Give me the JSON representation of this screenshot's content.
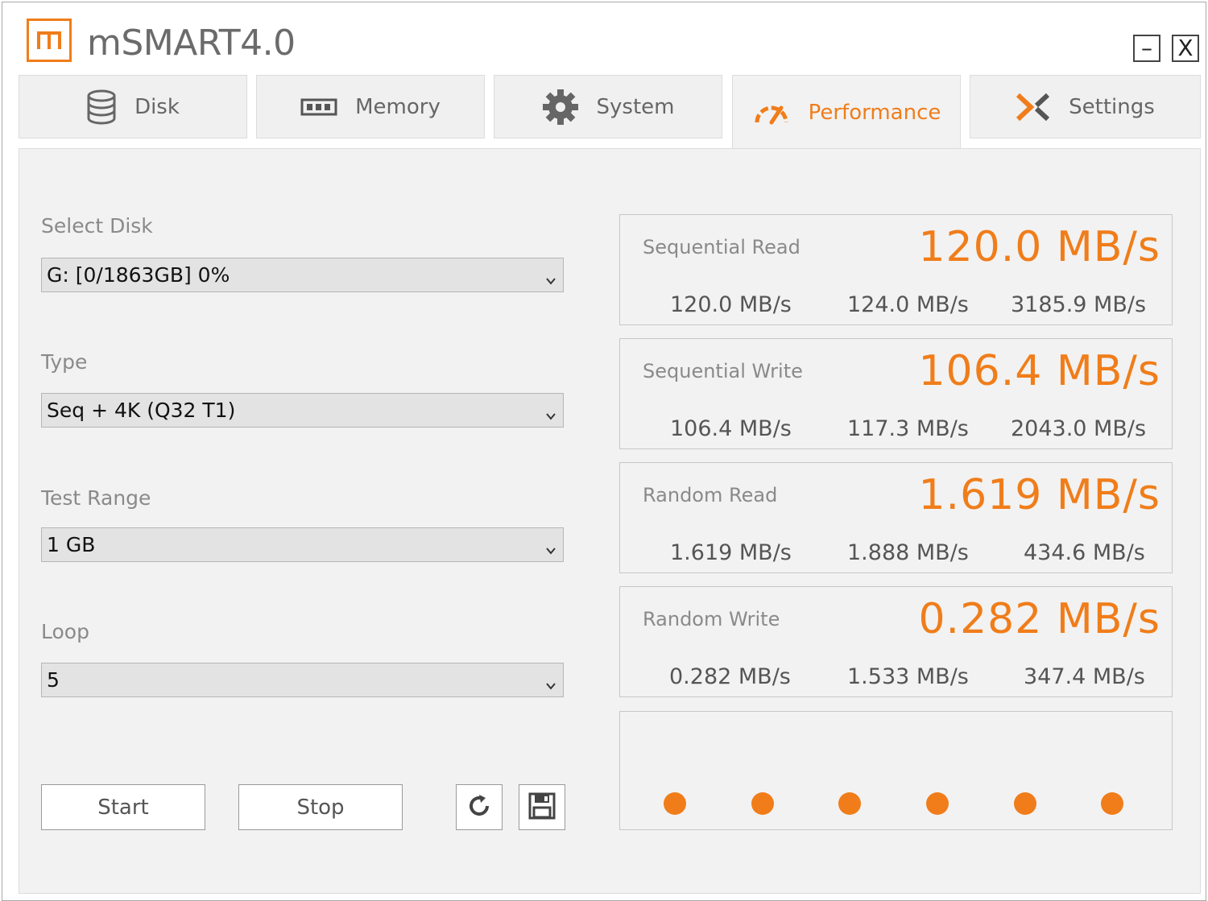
{
  "app": {
    "title": "mSMART4.0",
    "minimize_label": "–",
    "close_label": "X"
  },
  "tabs": [
    {
      "label": "Disk",
      "icon": "database-icon",
      "active": false
    },
    {
      "label": "Memory",
      "icon": "memory-chip-icon",
      "active": false
    },
    {
      "label": "System",
      "icon": "gear-icon",
      "active": false
    },
    {
      "label": "Performance",
      "icon": "speedometer-icon",
      "active": true
    },
    {
      "label": "Settings",
      "icon": "settings-x-icon",
      "active": false
    }
  ],
  "form": {
    "select_disk": {
      "label": "Select Disk",
      "value": "G: [0/1863GB] 0%"
    },
    "type": {
      "label": "Type",
      "value": "Seq + 4K (Q32 T1)"
    },
    "test_range": {
      "label": "Test Range",
      "value": "1 GB"
    },
    "loop": {
      "label": "Loop",
      "value": "5"
    }
  },
  "buttons": {
    "start": "Start",
    "stop": "Stop",
    "refresh_icon": "refresh-icon",
    "save_icon": "save-icon"
  },
  "results": [
    {
      "name": "Sequential Read",
      "main": "120.0 MB/s",
      "values": [
        "120.0 MB/s",
        "124.0 MB/s",
        "3185.9 MB/s"
      ]
    },
    {
      "name": "Sequential Write",
      "main": "106.4 MB/s",
      "values": [
        "106.4 MB/s",
        "117.3 MB/s",
        "2043.0 MB/s"
      ]
    },
    {
      "name": "Random Read",
      "main": "1.619 MB/s",
      "values": [
        "1.619 MB/s",
        "1.888 MB/s",
        "434.6 MB/s"
      ]
    },
    {
      "name": "Random Write",
      "main": "0.282 MB/s",
      "values": [
        "0.282 MB/s",
        "1.533 MB/s",
        "347.4 MB/s"
      ]
    }
  ],
  "progress_dots": 6,
  "colors": {
    "accent": "#f07d1a",
    "panel": "#f2f2f2",
    "label": "#8a8a8a"
  }
}
